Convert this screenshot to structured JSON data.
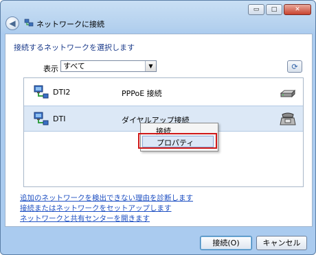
{
  "window": {
    "title": "ネットワークに接続",
    "minimize_glyph": "▭",
    "maximize_glyph": "□",
    "close_glyph": "✕",
    "back_glyph": "◀"
  },
  "main": {
    "heading": "接続するネットワークを選択します",
    "show_label": "表示",
    "filter_value": "すべて",
    "connections": [
      {
        "name": "DTI2",
        "type": "PPPoE 接続",
        "device_icon": "broadband-modem-icon"
      },
      {
        "name": "DTI",
        "type": "ダイヤルアップ接続",
        "device_icon": "dialup-phone-icon"
      }
    ]
  },
  "context_menu": {
    "items": [
      "接続",
      "プロパティ"
    ],
    "highlighted": "プロパティ"
  },
  "links": [
    "追加のネットワークを検出できない理由を診断します",
    "接続またはネットワークをセットアップします",
    "ネットワークと共有センターを開きます"
  ],
  "buttons": {
    "connect": "接続(O)",
    "cancel": "キャンセル"
  },
  "colors": {
    "heading": "#1a3a8a",
    "link": "#1d4fc2",
    "highlight_box": "#d01818",
    "selected_row": "#dce8f6"
  }
}
